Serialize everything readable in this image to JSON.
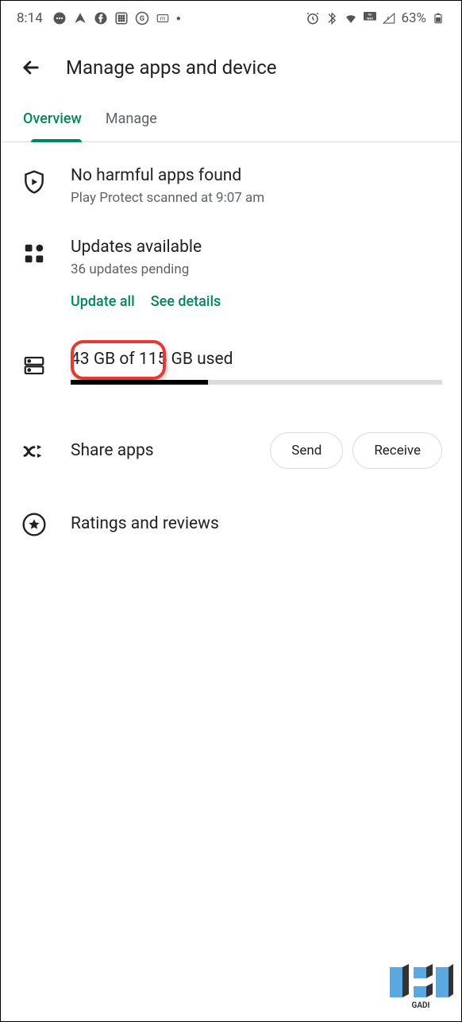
{
  "status_bar": {
    "time": "8:14",
    "battery_percent": "63%"
  },
  "header": {
    "title": "Manage apps and device"
  },
  "tabs": {
    "overview": "Overview",
    "manage": "Manage"
  },
  "protect": {
    "title": "No harmful apps found",
    "subtitle": "Play Protect scanned at 9:07 am"
  },
  "updates": {
    "title": "Updates available",
    "subtitle": "36 updates pending",
    "update_all": "Update all",
    "see_details": "See details"
  },
  "storage": {
    "text": "43 GB of 115 GB used",
    "percent_used": 37
  },
  "share": {
    "title": "Share apps",
    "send": "Send",
    "receive": "Receive"
  },
  "ratings": {
    "title": "Ratings and reviews"
  }
}
